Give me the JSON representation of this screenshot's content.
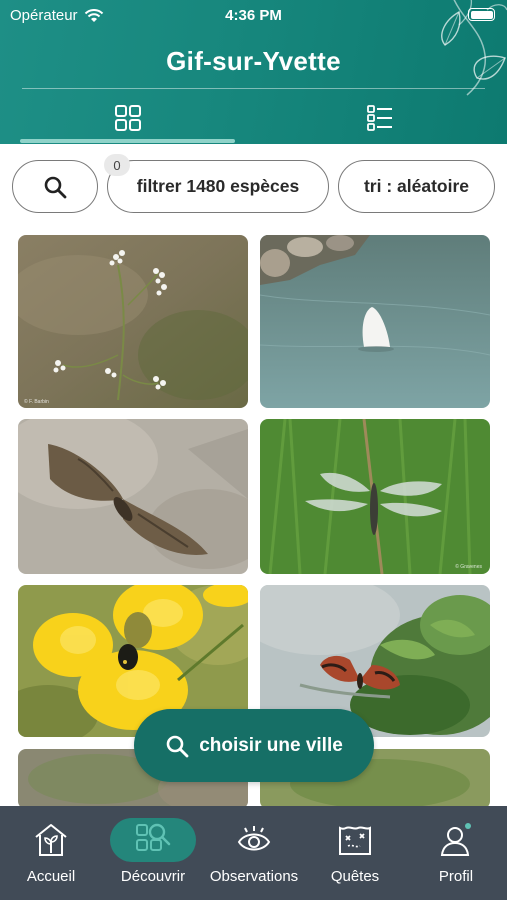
{
  "status_bar": {
    "carrier": "Opérateur",
    "time": "4:36 PM"
  },
  "header": {
    "city": "Gif-sur-Yvette",
    "active_view": "grid"
  },
  "controls": {
    "filter_count": "0",
    "filter_label": "filtrer 1480 espèces",
    "sort_label": "tri : aléatoire"
  },
  "grid": {
    "items": [
      {
        "subject": "white flower (umbellifer)",
        "credit": "© F. Barbin"
      },
      {
        "subject": "swan dabbling in water"
      },
      {
        "subject": "moth on stone"
      },
      {
        "subject": "dragonfly on stem",
        "credit": "© Gravenes"
      },
      {
        "subject": "beetle on yellow flower"
      },
      {
        "subject": "butterfly on leaves"
      }
    ]
  },
  "fab": {
    "label": "choisir une ville"
  },
  "tabbar": {
    "active": "Découvrir",
    "items": [
      {
        "label": "Accueil",
        "icon": "house-sprout-icon"
      },
      {
        "label": "Découvrir",
        "icon": "grid-search-icon"
      },
      {
        "label": "Observations",
        "icon": "eye-icon"
      },
      {
        "label": "Quêtes",
        "icon": "map-icon"
      },
      {
        "label": "Profil",
        "icon": "person-icon"
      }
    ]
  },
  "colors": {
    "primary": "#17877d",
    "fab": "#166f66",
    "tabbar": "#414b57",
    "accent": "#8fd3c9"
  }
}
